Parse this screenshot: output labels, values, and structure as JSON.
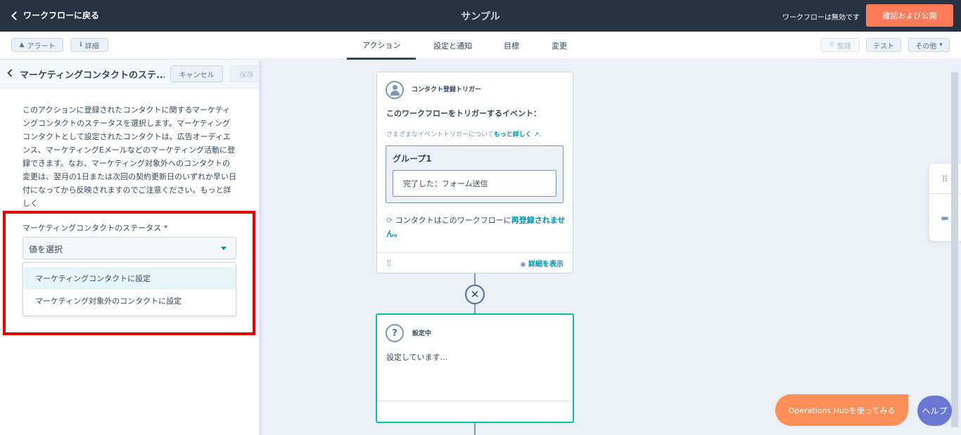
{
  "header": {
    "back_label": "ワークフローに戻る",
    "title": "サンプル",
    "status": "ワークフローは無効です",
    "publish_label": "確認および公開"
  },
  "toolbar": {
    "alert_label": "アラート",
    "details_label": "詳細",
    "tabs": [
      {
        "label": "アクション",
        "active": true
      },
      {
        "label": "設定と通知",
        "active": false
      },
      {
        "label": "目標",
        "active": false
      },
      {
        "label": "変更",
        "active": false
      }
    ],
    "organize_label": "整理",
    "test_label": "テスト",
    "more_label": "その他"
  },
  "panel": {
    "title": "マーケティングコンタクトのステ...",
    "cancel_label": "キャンセル",
    "save_label": "保存",
    "description": "このアクションに登録されたコンタクトに関するマーケティングコンタクトのステータスを選択します。マーケティングコンタクトとして設定されたコンタクトは、広告オーディエンス、マーケティングEメールなどのマーケティング活動に登録できます。なお、マーケティング対象外へのコンタクトの変更は、翌月の1日または次回の契約更新日のいずれか早い日付になってから反映されますのでご注意ください。もっと詳しく",
    "field_label": "マーケティングコンタクトのステータス *",
    "select_value": "値を選択",
    "options": [
      "マーケティングコンタクトに設定",
      "マーケティング対象外のコンタクトに設定"
    ]
  },
  "trigger_card": {
    "type_label": "コンタクト登録トリガー",
    "heading": "このワークフローをトリガーするイベント：",
    "note_prefix": "さまざまなイベントトリガーについて",
    "note_link": "もっと詳しく",
    "group_label": "グループ1",
    "condition": "完了した：フォーム送信",
    "reenroll_prefix": "コンタクトはこのワークフローに",
    "reenroll_link": "再登録されません。",
    "details_link": "詳細を表示"
  },
  "action_card": {
    "status_label": "設定中",
    "body": "設定しています..."
  },
  "help": {
    "ops_label": "Operations Hubを使ってみる",
    "help_label": "ヘルプ"
  },
  "colors": {
    "header_bg": "#253342",
    "accent": "#ff7a59",
    "link": "#0091ae",
    "highlight": "#e30000"
  }
}
